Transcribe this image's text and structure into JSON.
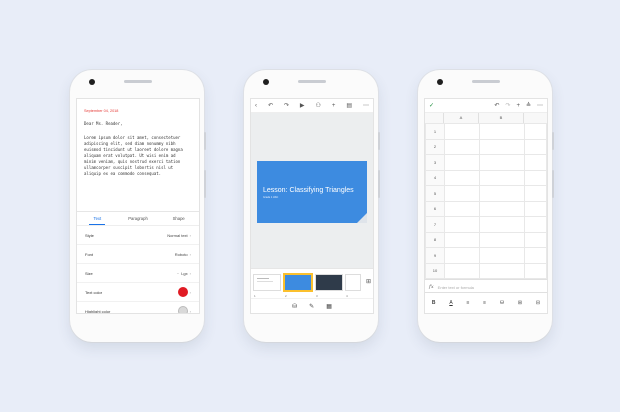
{
  "phone_docs": {
    "date": "September 04, 2018",
    "greeting": "Dear Ms. Reader,",
    "body_lines": [
      "Lorem ipsum dolor sit amet, consectetuer",
      "adipiscing elit, sed diam nonummy nibh",
      "euismod tincidunt ut laoreet dolore magna",
      "aliquam erat volutpat. Ut wisi enim ad",
      "minim veniam, quis nostrud exerci tation",
      "ullamcorper suscipit lobortis nisl ut",
      "aliquip ex ea commodo consequat."
    ],
    "tabs": [
      "Text",
      "Paragraph",
      "Shape"
    ],
    "rows": {
      "style": {
        "label": "Style",
        "value": "Normal text"
      },
      "font": {
        "label": "Font",
        "value": "Roboto"
      },
      "size": {
        "label": "Size",
        "value": "Lgx"
      },
      "text_color": {
        "label": "Text color"
      },
      "highlight_color": {
        "label": "Highlight color"
      }
    },
    "colors": {
      "text_color": "#e01b24",
      "highlight_color": "#d9d9d9"
    }
  },
  "phone_slides": {
    "slide_title": "Lesson: Classifying Triangles",
    "slide_subtitle": "Grade 1 ASC",
    "thumb_numbers": [
      "1",
      "2",
      "3",
      "4"
    ],
    "colors": {
      "slide": "#3d8be0",
      "selected": "#fbc02d"
    }
  },
  "phone_sheets": {
    "columns": [
      "A",
      "B"
    ],
    "rows": [
      "1",
      "2",
      "3",
      "4",
      "5",
      "6",
      "7",
      "8",
      "9",
      "10"
    ],
    "formula_placeholder": "Enter text or formula",
    "fx_label": "fx"
  }
}
